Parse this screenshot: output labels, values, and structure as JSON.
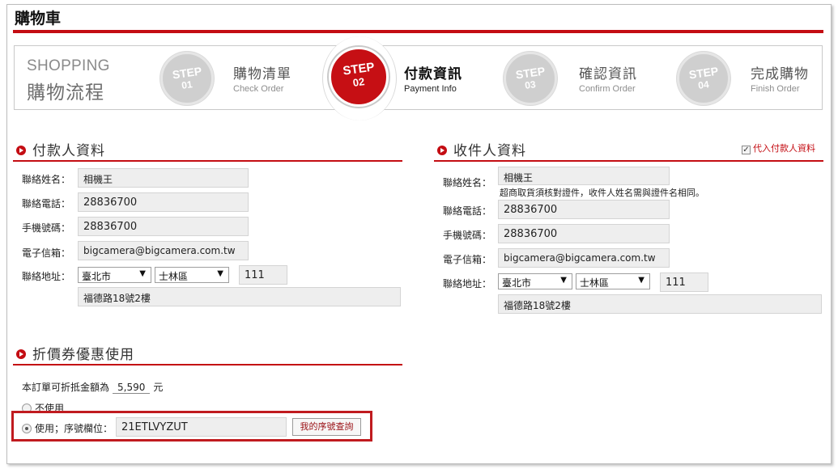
{
  "page": {
    "title": "購物車"
  },
  "steps": {
    "label_en": "SHOPPING",
    "label_zh": "購物流程",
    "items": [
      {
        "word": "STEP",
        "num": "01",
        "zh": "購物清單",
        "en": "Check Order",
        "active": false
      },
      {
        "word": "STEP",
        "num": "02",
        "zh": "付款資訊",
        "en": "Payment Info",
        "active": true
      },
      {
        "word": "STEP",
        "num": "03",
        "zh": "確認資訊",
        "en": "Confirm Order",
        "active": false
      },
      {
        "word": "STEP",
        "num": "04",
        "zh": "完成購物",
        "en": "Finish Order",
        "active": false
      }
    ]
  },
  "payer": {
    "heading": "付款人資料",
    "name_label": "聯絡姓名：",
    "name": "相機王",
    "phone_label": "聯絡電話：",
    "phone": "28836700",
    "mobile_label": "手機號碼：",
    "mobile": "28836700",
    "email_label": "電子信箱：",
    "email": "bigcamera@bigcamera.com.tw",
    "address_label": "聯絡地址：",
    "city": "臺北市",
    "district": "士林區",
    "zip": "111",
    "street": "福德路18號2樓"
  },
  "receiver": {
    "heading": "收件人資料",
    "copy_label": "代入付款人資料",
    "name_label": "聯絡姓名：",
    "name": "相機王",
    "name_note": "超商取貨須核對證件，收件人姓名需與證件名相同。",
    "phone_label": "聯絡電話：",
    "phone": "28836700",
    "mobile_label": "手機號碼：",
    "mobile": "28836700",
    "email_label": "電子信箱：",
    "email": "bigcamera@bigcamera.com.tw",
    "address_label": "聯絡地址：",
    "city": "臺北市",
    "district": "士林區",
    "zip": "111",
    "street": "福德路18號2樓"
  },
  "coupon": {
    "heading": "折價券優惠使用",
    "amount_prefix": "本訂單可折抵金額為",
    "amount": "5,590",
    "amount_suffix": "元",
    "option_none": "不使用",
    "option_use": "使用；序號欄位：",
    "serial": "21ETLVYZUT",
    "lookup_button": "我的序號查詢"
  },
  "colors": {
    "accent": "#c40d13",
    "field_bg": "#eeeeee",
    "step_inactive": "#cfcfcf"
  }
}
